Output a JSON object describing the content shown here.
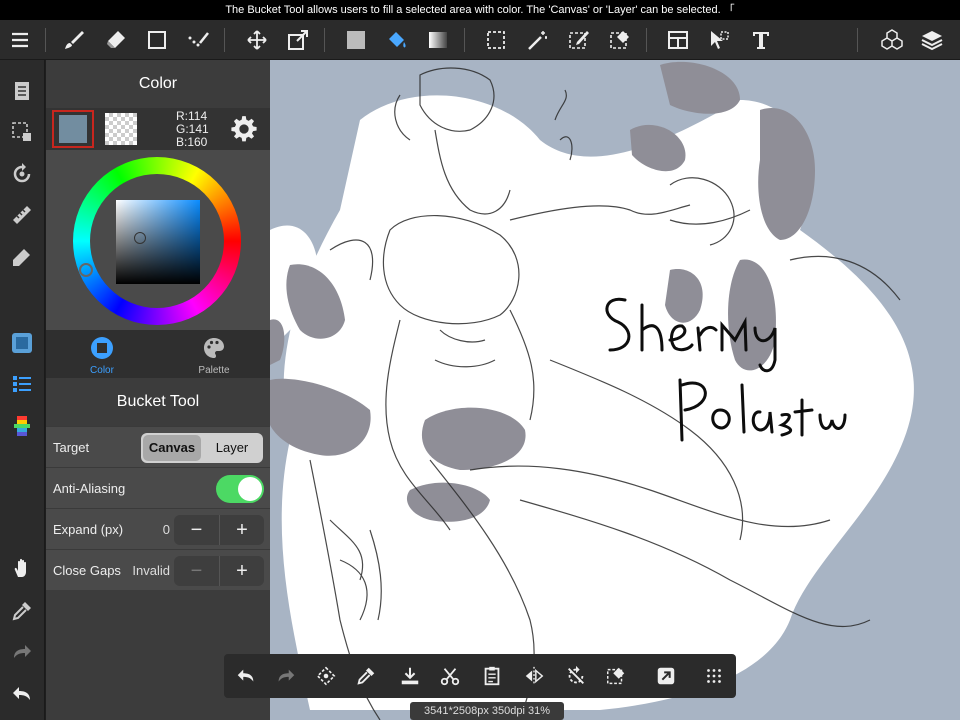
{
  "hint_text": "The Bucket Tool allows users to fill a selected area with color. The 'Canvas' or 'Layer' can be selected. 「",
  "colors": {
    "current_color": "#728da0",
    "accent_toggle": "#4cd964",
    "canvas_bg": "#a8b4c4"
  },
  "toolbar": {
    "icons": [
      "menu-icon",
      "brush-icon",
      "eraser-icon",
      "rect-shape-icon",
      "dotted-pen-icon",
      "move-icon",
      "transform-icon",
      "fill-color-icon",
      "bucket-icon",
      "gradient-icon",
      "select-rect-icon",
      "magic-wand-icon",
      "select-pen-icon",
      "select-eraser-icon",
      "frame-icon",
      "select-layer-icon",
      "text-icon",
      "3d-model-icon",
      "layers-icon"
    ]
  },
  "color_panel": {
    "title": "Color",
    "rgb": {
      "r": "R:114",
      "g": "G:141",
      "b": "B:160"
    },
    "tabs": [
      {
        "label": "Color",
        "icon": "square-circle-icon",
        "active": true
      },
      {
        "label": "Palette",
        "icon": "palette-icon",
        "active": false
      }
    ]
  },
  "bucket_panel": {
    "title": "Bucket Tool",
    "target": {
      "label": "Target",
      "options": [
        "Canvas",
        "Layer"
      ],
      "selected": "Canvas"
    },
    "anti_aliasing": {
      "label": "Anti-Aliasing",
      "enabled": true
    },
    "expand": {
      "label": "Expand (px)",
      "value": "0",
      "minus": "−",
      "plus": "+"
    },
    "close_gaps": {
      "label": "Close Gaps",
      "value": "Invalid",
      "minus": "−",
      "plus": "+"
    }
  },
  "status": "3541*2508px 350dpi 31%"
}
